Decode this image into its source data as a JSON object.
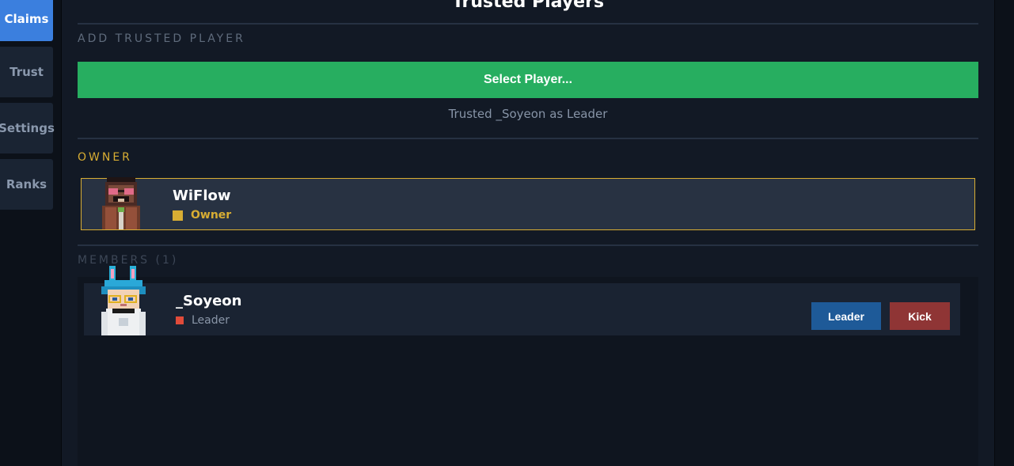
{
  "sidebar": {
    "items": [
      {
        "label": "Claims",
        "active": true
      },
      {
        "label": "Trust",
        "active": false
      },
      {
        "label": "Settings",
        "active": false
      },
      {
        "label": "Ranks",
        "active": false
      }
    ]
  },
  "page": {
    "title": "Trusted Players"
  },
  "add_section": {
    "label": "ADD TRUSTED PLAYER",
    "select_button": "Select Player...",
    "status": "Trusted _Soyeon as Leader"
  },
  "owner_section": {
    "label": "OWNER",
    "player": {
      "name": "WiFlow",
      "rank": "Owner",
      "rank_color": "#d8ad33"
    }
  },
  "members_section": {
    "label": "MEMBERS (1)",
    "members": [
      {
        "name": "_Soyeon",
        "rank": "Leader",
        "rank_color": "#e04b3a",
        "actions": {
          "promote": "Leader",
          "kick": "Kick"
        }
      }
    ]
  },
  "colors": {
    "accent": "#3b7fde",
    "success": "#27ae60",
    "owner_gold": "#d8ad33",
    "leader_button": "#1e5a98",
    "kick_button": "#8f3535"
  }
}
